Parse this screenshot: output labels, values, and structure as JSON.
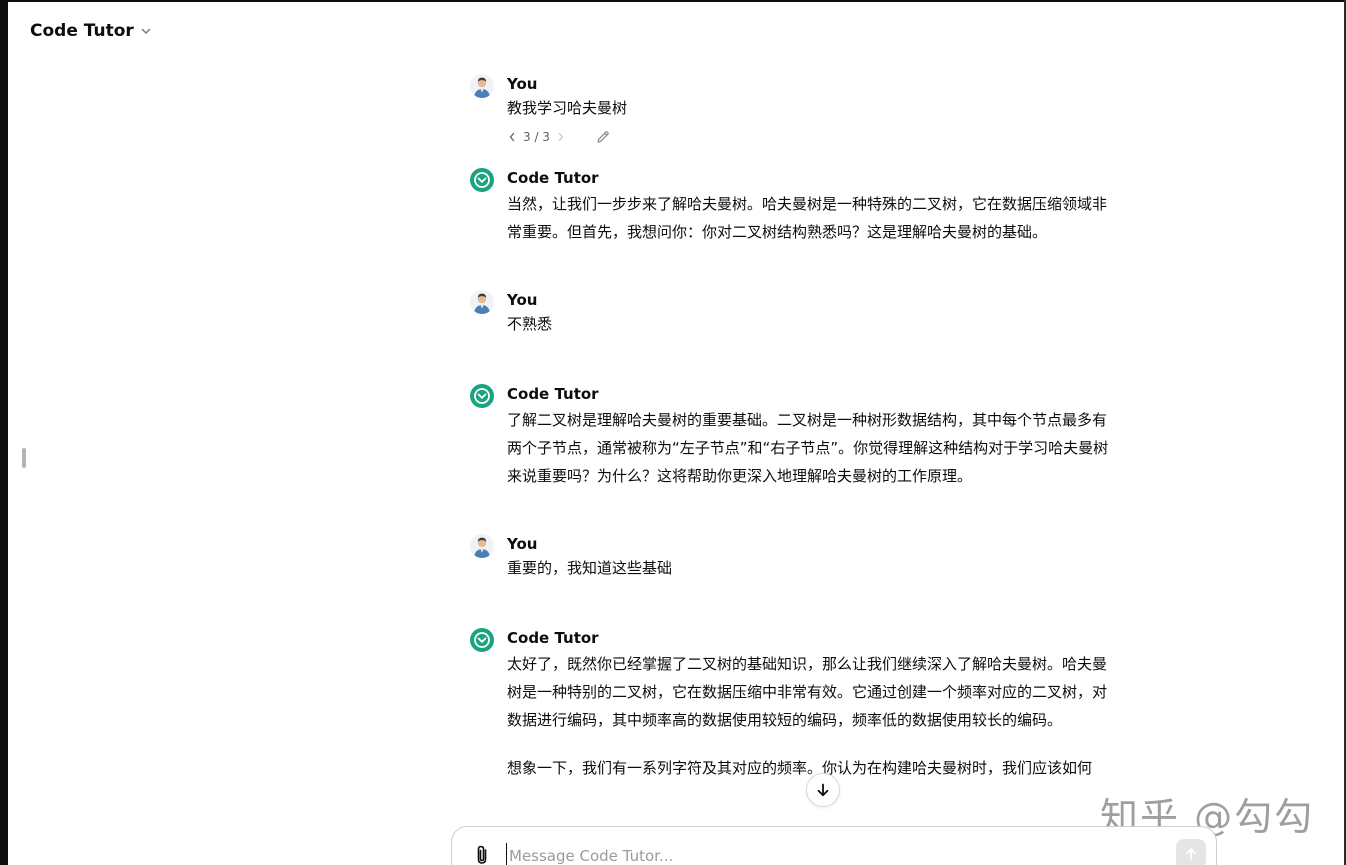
{
  "header": {
    "model_name": "Code Tutor"
  },
  "conversation": {
    "user_author": "You",
    "bot_author": "Code Tutor",
    "first_prompt": "教我学习哈夫曼树",
    "version_pager": "3 / 3",
    "bot_reply_1": "当然，让我们一步步来了解哈夫曼树。哈夫曼树是一种特殊的二叉树，它在数据压缩领域非常重要。但首先，我想问你：你对二叉树结构熟悉吗？这是理解哈夫曼树的基础。",
    "user_reply_2": "不熟悉",
    "bot_reply_2": "了解二叉树是理解哈夫曼树的重要基础。二叉树是一种树形数据结构，其中每个节点最多有两个子节点，通常被称为“左子节点”和“右子节点”。你觉得理解这种结构对于学习哈夫曼树来说重要吗？为什么？这将帮助你更深入地理解哈夫曼树的工作原理。",
    "user_reply_3": "重要的，我知道这些基础",
    "bot_reply_3_p1": "太好了，既然你已经掌握了二叉树的基础知识，那么让我们继续深入了解哈夫曼树。哈夫曼树是一种特别的二叉树，它在数据压缩中非常有效。它通过创建一个频率对应的二叉树，对数据进行编码，其中频率高的数据使用较短的编码，频率低的数据使用较长的编码。",
    "bot_reply_3_p2": "想象一下，我们有一系列字符及其对应的频率。你认为在构建哈夫曼树时，我们应该如何"
  },
  "composer": {
    "placeholder": "Message Code Tutor..."
  },
  "watermark": {
    "text": "知乎 @勾勾"
  },
  "colors": {
    "bot_avatar": "#1aa37f",
    "text": "#0d0d0d",
    "muted": "#5d5d5d"
  },
  "icons": {
    "model_menu": "chevron-down-icon",
    "user_avatar": "user-avatar-icon",
    "bot_avatar": "code-tutor-logo-icon",
    "edit": "pencil-icon",
    "scroll": "arrow-down-icon",
    "attach": "paperclip-icon",
    "send": "arrow-up-icon"
  }
}
